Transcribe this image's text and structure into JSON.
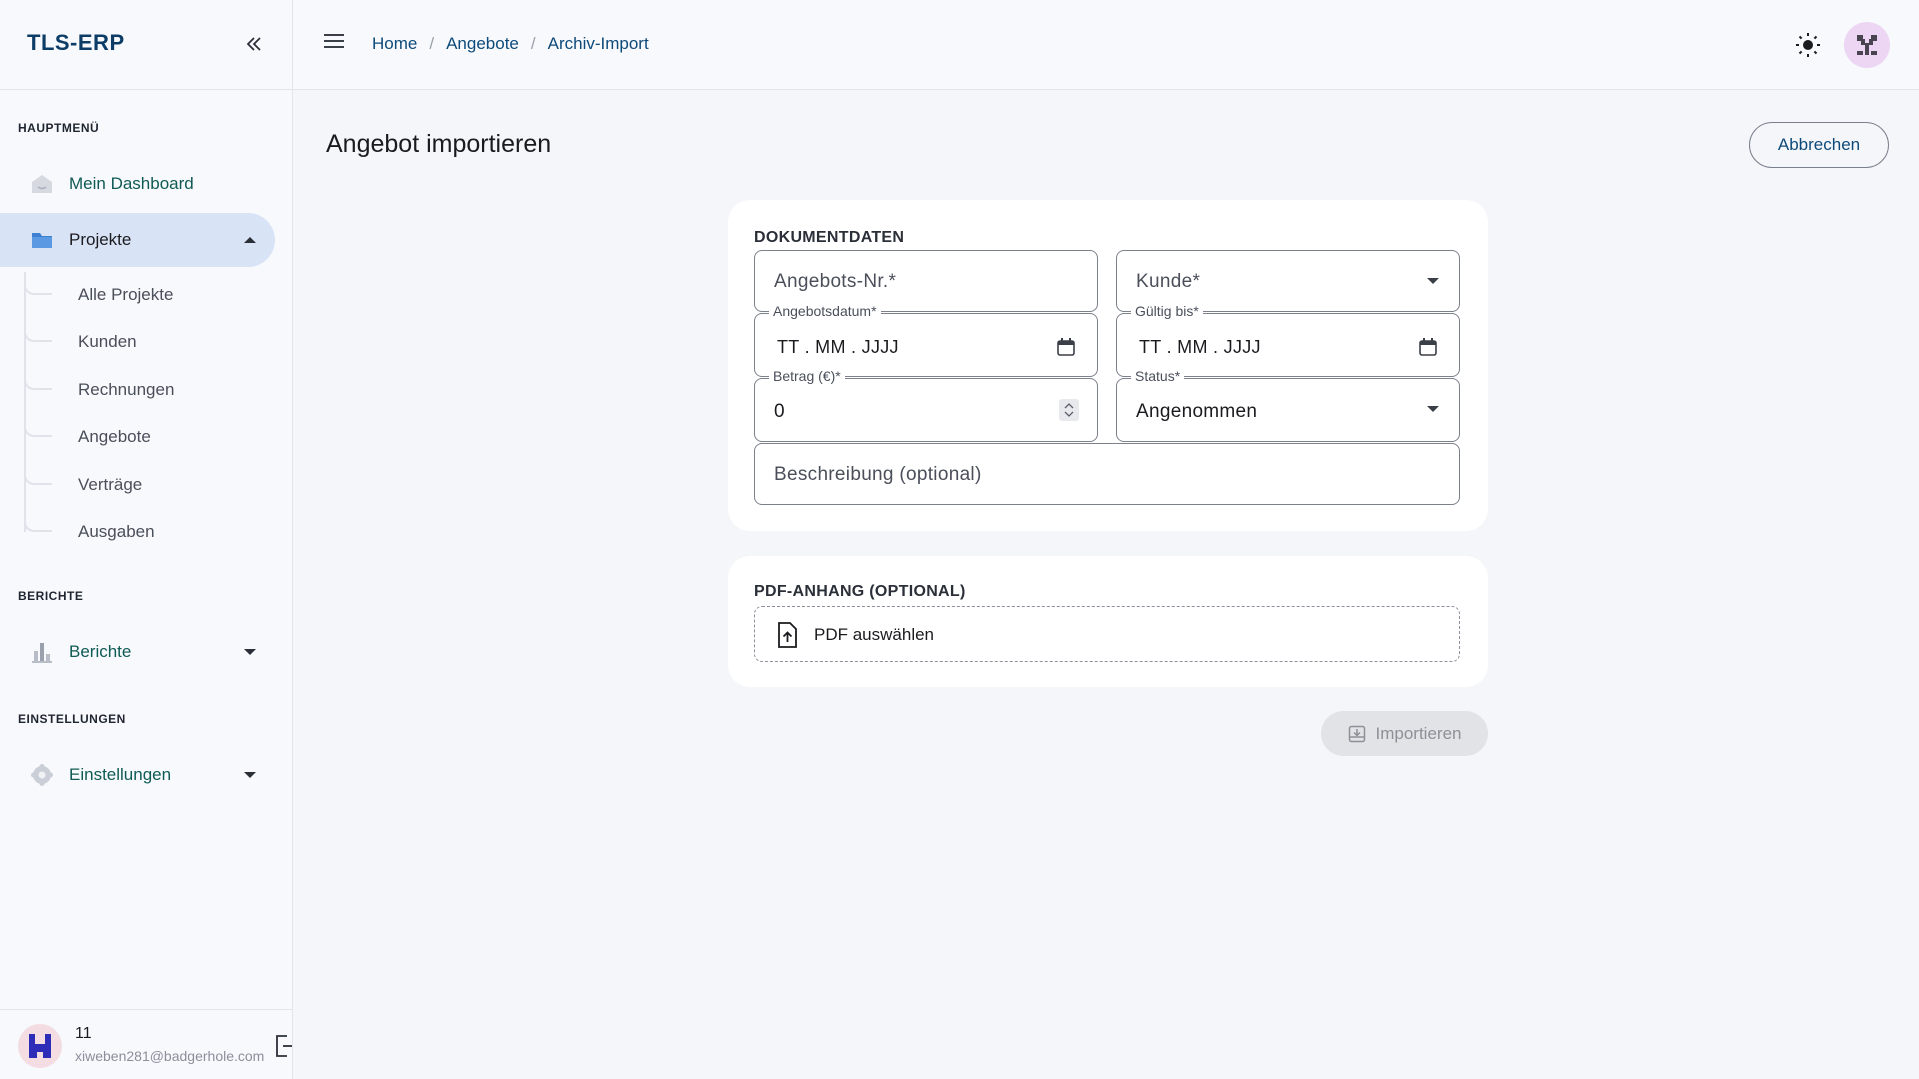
{
  "app": {
    "brand": "TLS-ERP"
  },
  "sidebar": {
    "sections": {
      "main": "HAUPTMENÜ",
      "reports": "BERICHTE",
      "settings": "EINSTELLUNGEN"
    },
    "items": {
      "dashboard": "Mein Dashboard",
      "projects": "Projekte",
      "reports": "Berichte",
      "settings": "Einstellungen"
    },
    "sub_items": [
      "Alle Projekte",
      "Kunden",
      "Rechnungen",
      "Angebote",
      "Verträge",
      "Ausgaben"
    ],
    "user": {
      "name": "11",
      "email": "xiweben281@badgerhole.com"
    }
  },
  "breadcrumb": [
    "Home",
    "Angebote",
    "Archiv-Import"
  ],
  "page": {
    "title": "Angebot importieren",
    "cancel_label": "Abbrechen",
    "import_label": "Importieren"
  },
  "form": {
    "section_title": "DOKUMENTDATEN",
    "offer_no_placeholder": "Angebots-Nr.*",
    "customer_placeholder": "Kunde*",
    "offer_date_label": "Angebotsdatum*",
    "offer_date_value": "TT . MM . JJJJ",
    "valid_until_label": "Gültig bis*",
    "valid_until_value": "TT . MM . JJJJ",
    "amount_label": "Betrag (€)*",
    "amount_value": "0",
    "status_label": "Status*",
    "status_value": "Angenommen",
    "description_placeholder": "Beschreibung (optional)"
  },
  "attachment": {
    "section_title": "PDF-ANHANG (OPTIONAL)",
    "select_label": "PDF auswählen"
  },
  "colors": {
    "accent": "#0d4a7a",
    "nav_text": "#0f5a54",
    "active_bg": "#d9e3f6"
  }
}
